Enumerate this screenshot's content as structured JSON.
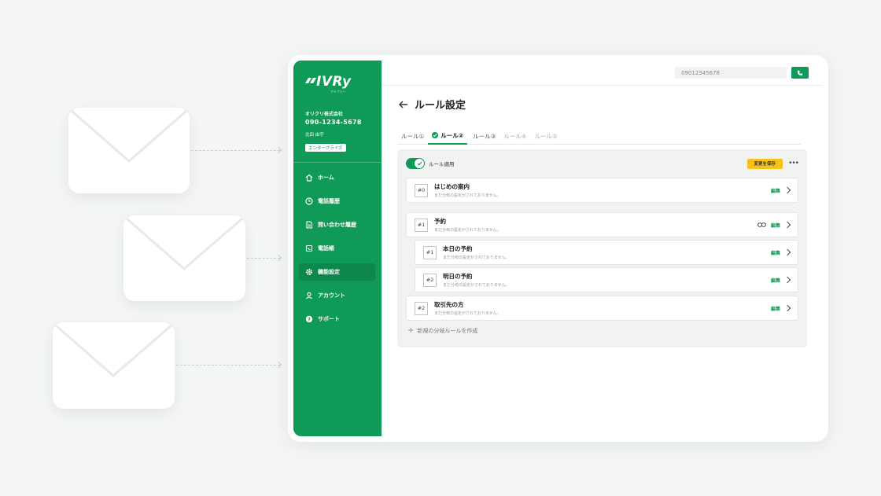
{
  "colors": {
    "brand": "#0f9a57",
    "save": "#f7c31b"
  },
  "sidebar": {
    "logo": "IVRy",
    "logo_sub": "アイブリー",
    "company": "オリクリ株式会社",
    "phone": "090-1234-5678",
    "user": "北田 由宇",
    "plan": "エンタープライズ",
    "items": [
      {
        "label": "ホーム",
        "icon": "home-icon"
      },
      {
        "label": "電話履歴",
        "icon": "clock-icon"
      },
      {
        "label": "問い合わせ履歴",
        "icon": "document-icon"
      },
      {
        "label": "電話帳",
        "icon": "phonebook-icon"
      },
      {
        "label": "機能設定",
        "icon": "gear-icon"
      },
      {
        "label": "アカウント",
        "icon": "person-icon"
      },
      {
        "label": "サポート",
        "icon": "help-icon"
      }
    ]
  },
  "header": {
    "phone_value": "09012345678"
  },
  "page": {
    "title": "ルール設定"
  },
  "tabs": [
    "ルール①",
    "ルール②",
    "ルール③",
    "ルール④",
    "ルール⑤"
  ],
  "panel": {
    "toggle_label": "ルール適用",
    "save_label": "変更を保存",
    "add_label": "新規の分岐ルールを作成"
  },
  "rules": [
    {
      "num": "#0",
      "name": "はじめの案内",
      "sub": "まだ分岐の設定がされておりません。",
      "edit": "編集"
    },
    {
      "num": "#1",
      "name": "予約",
      "sub": "まだ分岐の設定がされておりません。",
      "edit": "編集"
    },
    {
      "num": "#1",
      "name": "本日の予約",
      "sub": "まだ分岐の設定がされておりません。",
      "edit": "編集"
    },
    {
      "num": "#2",
      "name": "明日の予約",
      "sub": "まだ分岐の設定がされておりません。",
      "edit": "編集"
    },
    {
      "num": "#2",
      "name": "取引先の方",
      "sub": "まだ分岐の設定がされておりません。",
      "edit": "編集"
    }
  ]
}
